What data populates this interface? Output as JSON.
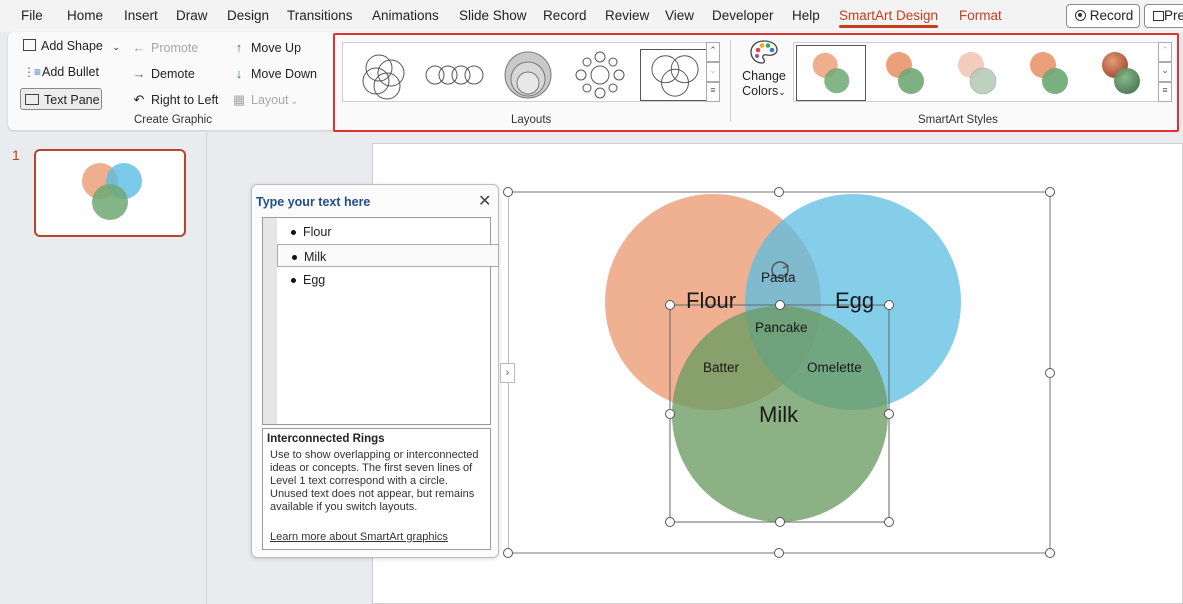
{
  "menubar": {
    "tabs": [
      "File",
      "Home",
      "Insert",
      "Draw",
      "Design",
      "Transitions",
      "Animations",
      "Slide Show",
      "Record",
      "Review",
      "View",
      "Developer",
      "Help",
      "SmartArt Design",
      "Format"
    ],
    "active_tab": "SmartArt Design",
    "record_button": "Record",
    "present_button": "Pre"
  },
  "ribbon": {
    "create_graphic": {
      "add_shape": "Add Shape",
      "add_bullet": "Add Bullet",
      "text_pane": "Text Pane",
      "promote": "Promote",
      "demote": "Demote",
      "right_to_left": "Right to Left",
      "move_up": "Move Up",
      "move_down": "Move Down",
      "layout": "Layout",
      "group_label": "Create Graphic"
    },
    "layouts": {
      "group_label": "Layouts"
    },
    "change_colors": {
      "line1": "Change",
      "line2": "Colors"
    },
    "smartart_styles": {
      "group_label": "SmartArt Styles"
    }
  },
  "slides_panel": {
    "slide_number": "1"
  },
  "text_pane": {
    "title": "Type your text here",
    "items": [
      "Flour",
      "Milk",
      "Egg"
    ],
    "info_title": "Interconnected Rings",
    "info_body": "Use to show overlapping or interconnected ideas or concepts. The first seven lines of Level 1 text correspond with a circle. Unused text does not appear, but remains available if you switch layouts.",
    "learn_more": "Learn more about SmartArt graphics"
  },
  "diagram": {
    "circles": [
      {
        "label": "Flour",
        "color": "#eca07a"
      },
      {
        "label": "Egg",
        "color": "#5bbde3"
      },
      {
        "label": "Milk",
        "color": "#6fa874"
      }
    ],
    "overlaps": {
      "flour_egg": "Pasta",
      "center": "Pancake",
      "flour_milk": "Batter",
      "egg_milk": "Omelette"
    }
  },
  "colors": {
    "accent": "#c43e1c",
    "highlight_border": "#e03030"
  }
}
